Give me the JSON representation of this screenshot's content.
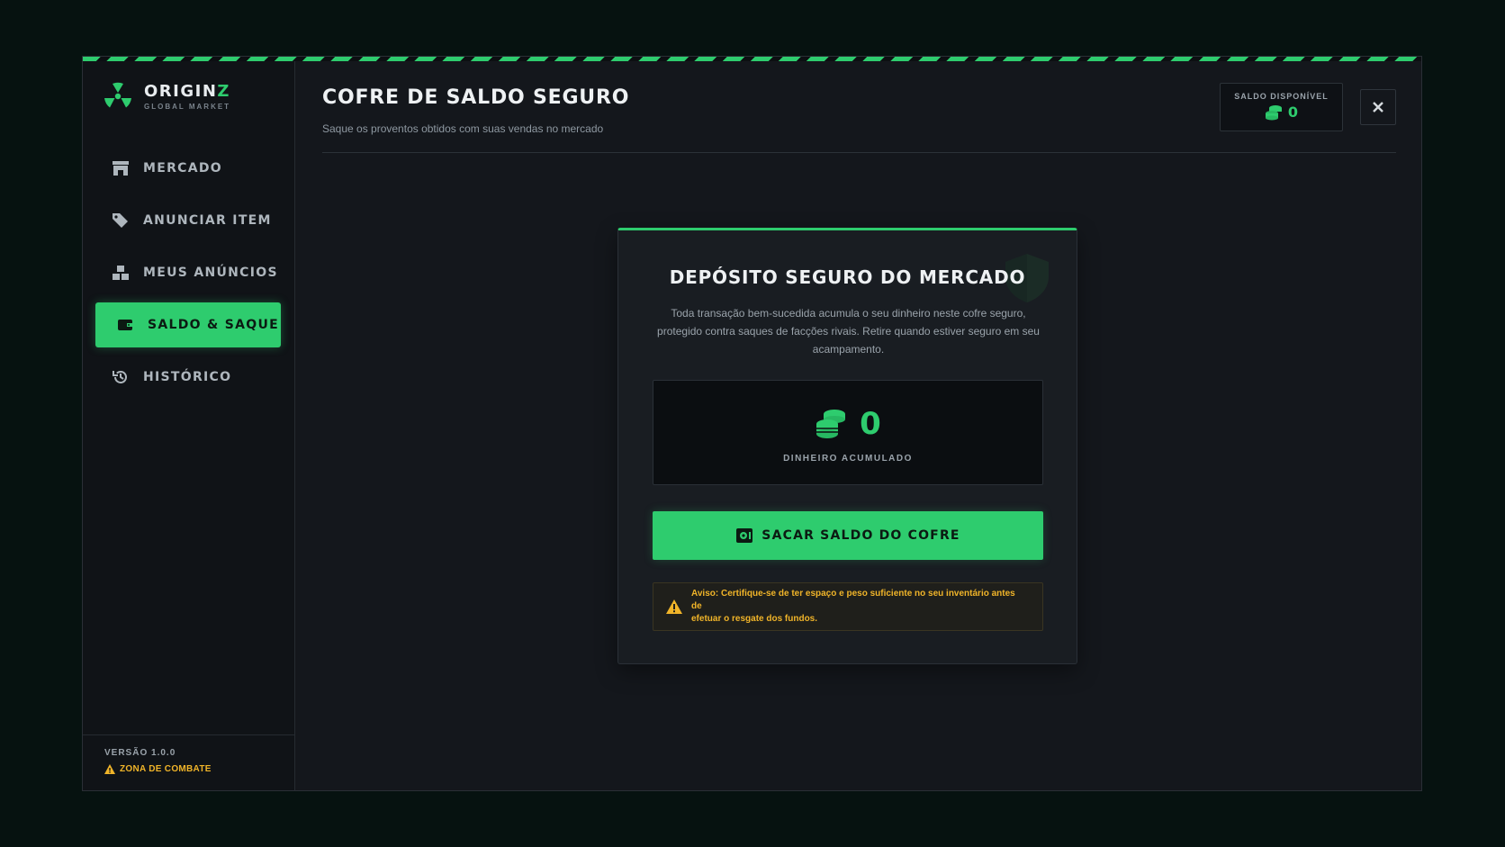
{
  "brand": {
    "name_main": "ORIGIN",
    "name_accent": "Z",
    "subtitle": "GLOBAL MARKET",
    "icon": "radiation-icon"
  },
  "nav": {
    "items": [
      {
        "label": "MERCADO",
        "icon": "store-icon",
        "active": false
      },
      {
        "label": "ANUNCIAR ITEM",
        "icon": "tags-icon",
        "active": false
      },
      {
        "label": "MEUS ANÚNCIOS",
        "icon": "boxes-icon",
        "active": false
      },
      {
        "label": "SALDO & SAQUE",
        "icon": "wallet-icon",
        "active": true
      },
      {
        "label": "HISTÓRICO",
        "icon": "history-icon",
        "active": false
      }
    ]
  },
  "footer": {
    "version": "VERSÃO 1.0.0",
    "zone": "ZONA DE COMBATE",
    "zone_icon": "warning-icon"
  },
  "header": {
    "title": "COFRE DE SALDO SEGURO",
    "subtitle": "Saque os proventos obtidos com suas vendas no mercado",
    "balance_label": "SALDO DISPONÍVEL",
    "balance_value": "0",
    "close_icon": "close-icon"
  },
  "card": {
    "title": "DEPÓSITO SEGURO DO MERCADO",
    "description_lines": [
      "Toda transação bem-sucedida acumula o seu dinheiro neste cofre seguro,",
      "protegido contra saques de facções rivais. Retire quando estiver seguro em seu",
      "acampamento."
    ],
    "amount": "0",
    "amount_label": "DINHEIRO ACUMULADO",
    "withdraw_label": "SACAR SALDO DO COFRE",
    "warning_lines": [
      "Aviso: Certifique-se de ter espaço e peso suficiente no seu inventário antes de",
      "efetuar o resgate dos fundos."
    ]
  },
  "colors": {
    "accent": "#2ecc6e",
    "warning": "#f0b429",
    "background": "#14171c"
  }
}
